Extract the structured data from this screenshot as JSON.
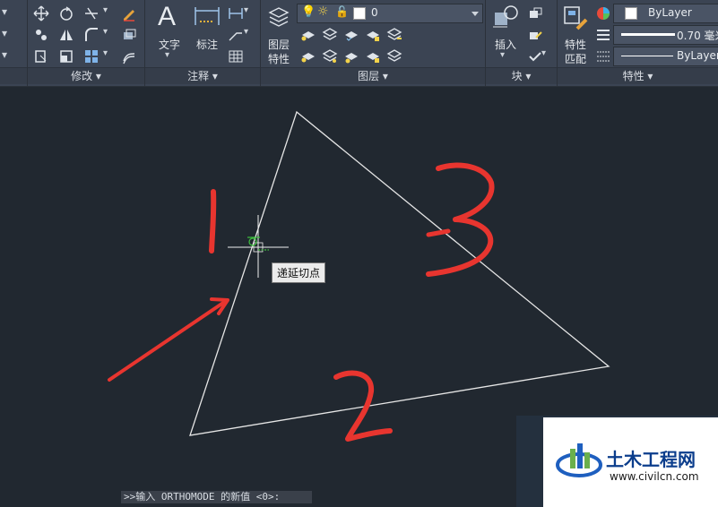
{
  "ribbon": {
    "modify": {
      "title": "修改"
    },
    "annotate": {
      "title": "注释",
      "text_label": "文字",
      "dimension_label": "标注"
    },
    "layers": {
      "title": "图层",
      "layer_props_label_1": "图层",
      "layer_props_label_2": "特性",
      "current_layer": "0"
    },
    "block": {
      "title": "块",
      "insert_label": "插入"
    },
    "properties": {
      "title": "特性",
      "match_label_1": "特性",
      "match_label_2": "匹配",
      "color": "ByLayer",
      "lineweight": "0.70 毫米",
      "linetype": "ByLayer"
    }
  },
  "canvas": {
    "tooltip": "递延切点",
    "annotations": [
      "1",
      "2",
      "3"
    ]
  },
  "command_line": {
    "text": ">>输入 ORTHOMODE 的新值 <0>:"
  },
  "watermark": {
    "title": "土木工程网",
    "url": "www.civilcn.com"
  },
  "colors": {
    "background": "#212830",
    "ribbon": "#3b4453",
    "annotation_red": "#e8352f",
    "geometry": "#e6e6e6",
    "snap_marker": "#3fc13f"
  }
}
